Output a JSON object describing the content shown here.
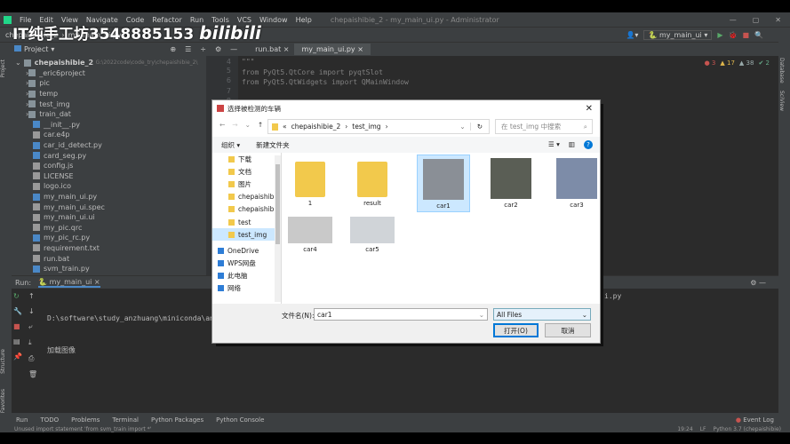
{
  "menu": [
    "File",
    "Edit",
    "View",
    "Navigate",
    "Code",
    "Refactor",
    "Run",
    "Tools",
    "VCS",
    "Window",
    "Help"
  ],
  "window_title": "chepaishibie_2 - my_main_ui.py - Administrator",
  "nav": {
    "project": "chepaishibie_2",
    "file": "my_main_ui.py"
  },
  "watermark": "IT纯手工坊3548885153",
  "watermark_logo": "bilibili",
  "toolbar": {
    "project_label": "Project",
    "tabs": [
      "run.bat",
      "my_main_ui.py"
    ],
    "run_config": "my_main_ui"
  },
  "tree": {
    "root": "chepaishibie_2",
    "root_path": "G:\\2022code\\code_try\\chepaishibie_2\\",
    "items": [
      {
        "name": "_eric6project",
        "type": "folder"
      },
      {
        "name": "pic",
        "type": "folder"
      },
      {
        "name": "temp",
        "type": "folder"
      },
      {
        "name": "test_img",
        "type": "folder"
      },
      {
        "name": "train_dat",
        "type": "folder"
      },
      {
        "name": "__init__.py",
        "type": "py"
      },
      {
        "name": "car.e4p",
        "type": "file"
      },
      {
        "name": "car_id_detect.py",
        "type": "py"
      },
      {
        "name": "card_seg.py",
        "type": "py"
      },
      {
        "name": "config.js",
        "type": "file"
      },
      {
        "name": "LICENSE",
        "type": "file"
      },
      {
        "name": "logo.ico",
        "type": "file"
      },
      {
        "name": "my_main_ui.py",
        "type": "py"
      },
      {
        "name": "my_main_ui.spec",
        "type": "file"
      },
      {
        "name": "my_main_ui.ui",
        "type": "file"
      },
      {
        "name": "my_pic.qrc",
        "type": "file"
      },
      {
        "name": "my_pic_rc.py",
        "type": "py"
      },
      {
        "name": "requirement.txt",
        "type": "file"
      },
      {
        "name": "run.bat",
        "type": "file"
      },
      {
        "name": "svm_train.py",
        "type": "py"
      }
    ]
  },
  "editor": {
    "lines": [
      {
        "n": "4",
        "code": "\"\"\""
      },
      {
        "n": "5",
        "code": "from PyQt5.QtCore import pyqtSlot"
      },
      {
        "n": "6",
        "code": "from PyQt5.QtWidgets import QMainWindow"
      },
      {
        "n": "7",
        "code": ""
      },
      {
        "n": "8",
        "code": ""
      }
    ],
    "inspections": {
      "errors": "3",
      "warnings": "17",
      "weak": "38",
      "typos": "2"
    }
  },
  "run": {
    "label": "Run:",
    "config": "my_main_ui",
    "output": [
      "D:\\software\\study_anzhuang\\miniconda\\an",
      "加载图像"
    ],
    "output_tail": "i.py"
  },
  "bottom_tabs": [
    "Run",
    "TODO",
    "Problems",
    "Terminal",
    "Python Packages",
    "Python Console"
  ],
  "event_log": "Event Log",
  "status": {
    "message": "Unused import statement 'from svm_train import *'",
    "position": "19:24",
    "eol": "LF",
    "interpreter": "Python 3.7 (chepaishibie)"
  },
  "side_labels": {
    "project": "Project",
    "structure": "Structure",
    "favorites": "Favorites",
    "database": "Database",
    "sciview": "SciView"
  },
  "dialog": {
    "title": "选择被检测的车辆",
    "breadcrumb": [
      "chepaishibie_2",
      "test_img"
    ],
    "search_placeholder": "在 test_img 中搜索",
    "organize": "组织 ▾",
    "new_folder": "新建文件夹",
    "nav": [
      "下载",
      "文档",
      "图片",
      "chepaishibi",
      "chepaishibi",
      "test",
      "test_img",
      "OneDrive",
      "WPS网盘",
      "此电脑",
      "网络"
    ],
    "files": [
      {
        "name": "1",
        "kind": "folder"
      },
      {
        "name": "result",
        "kind": "folder"
      },
      {
        "name": "car1",
        "kind": "image",
        "selected": true
      },
      {
        "name": "car2",
        "kind": "image"
      },
      {
        "name": "car3",
        "kind": "image"
      },
      {
        "name": "car4",
        "kind": "image"
      },
      {
        "name": "car5",
        "kind": "image"
      }
    ],
    "filename_label": "文件名(N):",
    "filename_value": "car1",
    "filter": "All Files",
    "open": "打开(O)",
    "cancel": "取消"
  },
  "colors": {
    "ide_bg": "#2b2b2b",
    "panel": "#3c3f41",
    "selection": "#cce8ff",
    "accent": "#0078d7"
  }
}
